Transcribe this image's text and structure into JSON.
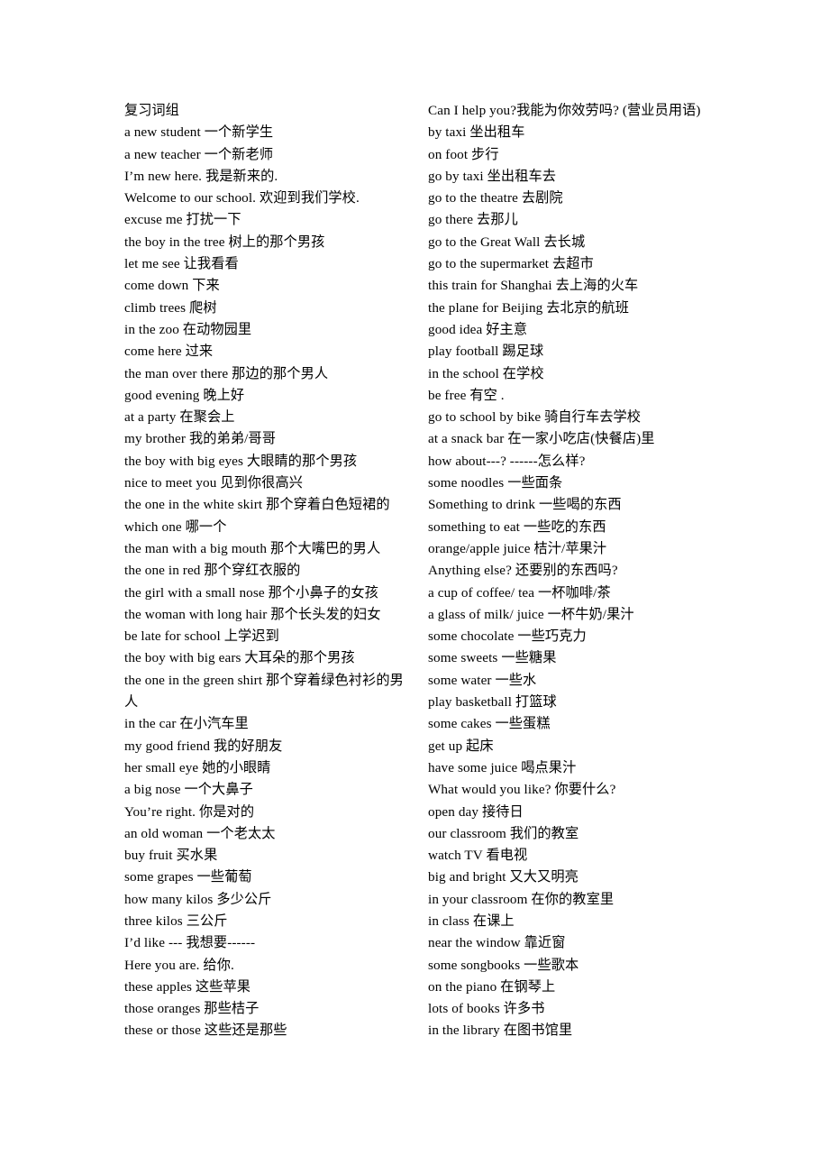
{
  "document": {
    "title": "复习词组",
    "background_color": "#ffffff",
    "text_color": "#000000",
    "layout": "two-column"
  },
  "left_column": {
    "heading": "复习词组",
    "lines": [
      "a new student  一个新学生",
      "a new teacher 一个新老师",
      "I’m new here.  我是新来的.",
      "Welcome to our school.  欢迎到我们学校.",
      "excuse me  打扰一下",
      "the boy in the tree  树上的那个男孩",
      "let me see  让我看看",
      "come down  下来",
      "climb trees  爬树",
      "in the zoo  在动物园里",
      "come here  过来",
      "the man over there  那边的那个男人",
      "good evening  晚上好",
      "at a party 在聚会上",
      "my brother  我的弟弟/哥哥",
      "the boy with big eyes 大眼睛的那个男孩",
      "nice to meet you  见到你很高兴",
      "the one in the white skirt  那个穿着白色短裙的",
      "which one  哪一个",
      "the man with a big mouth 那个大嘴巴的男人",
      "the one in red 那个穿红衣服的",
      "the girl with a small nose  那个小鼻子的女孩",
      "the woman with long hair 那个长头发的妇女",
      "be late for school 上学迟到",
      "the boy with big ears  大耳朵的那个男孩",
      "the one in the green shirt  那个穿着绿色衬衫的男人",
      "in the car  在小汽车里",
      "my good friend 我的好朋友",
      "her small eye 她的小眼睛",
      "a big nose 一个大鼻子",
      "You’re right.  你是对的",
      "an old woman  一个老太太",
      "buy fruit  买水果",
      "some grapes  一些葡萄",
      "how many kilos  多少公斤",
      "three kilos 三公斤",
      "I’d like ---  我想要------",
      "Here you are.  给你.",
      "these apples 这些苹果",
      "those oranges 那些桔子",
      "these or those 这些还是那些"
    ]
  },
  "right_column": {
    "lines": [
      "Can I help you?我能为你效劳吗? (营业员用语)",
      "by taxi 坐出租车",
      "on foot  步行",
      "go by taxi  坐出租车去",
      "go to the theatre 去剧院",
      "go there  去那儿",
      "go to the Great Wall 去长城",
      "go to the supermarket 去超市",
      "this train for Shanghai 去上海的火车",
      "the plane for Beijing  去北京的航班",
      "good idea  好主意",
      "play football  踢足球",
      "in the school  在学校",
      "be free  有空 .",
      "go to school by bike  骑自行车去学校",
      "at a snack bar 在一家小吃店(快餐店)里",
      "how about---? ------怎么样?",
      "some noodles  一些面条",
      "Something to drink 一些喝的东西",
      "something to eat 一些吃的东西",
      "orange/apple juice  桔汁/苹果汁",
      "Anything else?  还要别的东西吗?",
      "a cup of coffee/ tea  一杯咖啡/茶",
      "a glass of milk/ juice 一杯牛奶/果汁",
      "some chocolate  一些巧克力",
      "some sweets 一些糖果",
      "some water  一些水",
      "play basketball  打篮球",
      "some cakes  一些蛋糕",
      "get up  起床",
      "have some juice  喝点果汁",
      "What would you like?  你要什么?",
      "open day  接待日",
      "our classroom 我们的教室",
      "watch TV 看电视",
      "big and bright 又大又明亮",
      "in your classroom  在你的教室里",
      "in class 在课上",
      "near the window 靠近窗",
      "some songbooks 一些歌本",
      "on the piano 在钢琴上",
      "lots of books 许多书",
      "in the library 在图书馆里"
    ]
  }
}
